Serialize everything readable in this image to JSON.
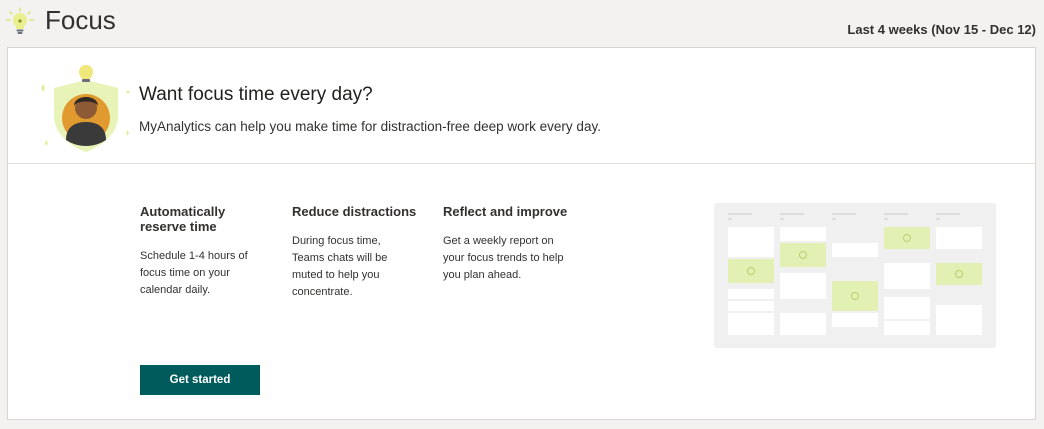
{
  "header": {
    "title": "Focus",
    "date_range": "Last 4 weeks (Nov 15 - Dec 12)",
    "icon": "lightbulb-icon"
  },
  "hero": {
    "title": "Want focus time every day?",
    "subtitle": "MyAnalytics can help you make time for distraction-free deep work every day.",
    "illustration": "person-with-lightbulb-shield"
  },
  "features": [
    {
      "title": "Automatically reserve time",
      "description": "Schedule 1-4 hours of focus time on your calendar daily."
    },
    {
      "title": "Reduce distractions",
      "description": "During focus time, Teams chats will be muted to help you concentrate."
    },
    {
      "title": "Reflect and improve",
      "description": "Get a weekly report on your focus trends to help you plan ahead."
    }
  ],
  "cta": {
    "label": "Get started"
  },
  "calendar_illustration": {
    "icon": "calendar-focus-blocks-illustration"
  },
  "colors": {
    "background": "#f3f2f1",
    "card": "#ffffff",
    "button": "#005b5c",
    "focus_block": "#e2f0b4",
    "accent_yellow": "#e8e87a"
  }
}
